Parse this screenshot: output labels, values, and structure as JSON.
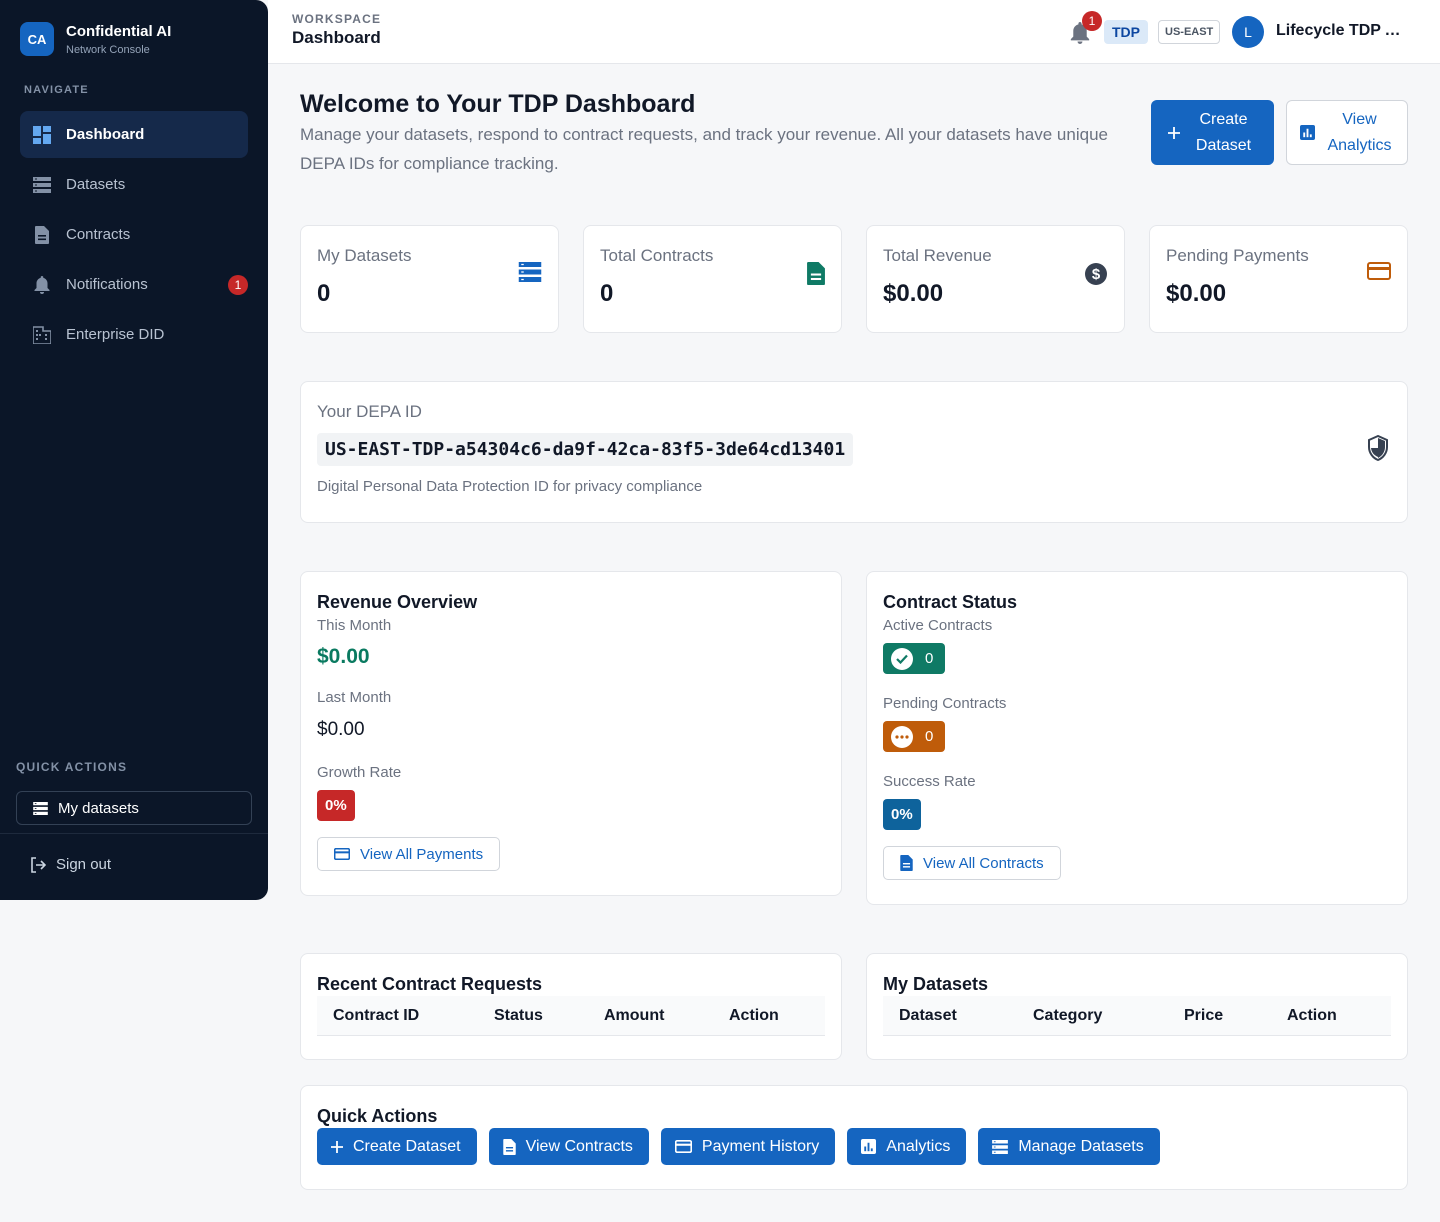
{
  "sidebar": {
    "brand_logo": "CA",
    "brand_title": "Confidential AI",
    "brand_subtitle": "Network Console",
    "nav_heading": "NAVIGATE",
    "items": [
      {
        "label": "Dashboard",
        "icon": "dashboard-icon",
        "active": true
      },
      {
        "label": "Datasets",
        "icon": "storage-icon"
      },
      {
        "label": "Contracts",
        "icon": "document-icon"
      },
      {
        "label": "Notifications",
        "icon": "bell-icon",
        "badge": "1"
      },
      {
        "label": "Enterprise DID",
        "icon": "building-icon"
      }
    ],
    "quick_actions_heading": "QUICK ACTIONS",
    "quick_action_button": "My datasets",
    "sign_out": "Sign out"
  },
  "header": {
    "workspace_label": "WORKSPACE",
    "title": "Dashboard",
    "notification_count": "1",
    "role_chip": "TDP",
    "region_chip": "US-EAST",
    "avatar_initial": "L",
    "user_name": "Lifecycle TDP Admin"
  },
  "welcome": {
    "title": "Welcome to Your TDP Dashboard",
    "subtitle": "Manage your datasets, respond to contract requests, and track your revenue. All your datasets have unique DEPA IDs for compliance tracking.",
    "create_button": "Create Dataset",
    "analytics_button": "View Analytics"
  },
  "stats": [
    {
      "label": "My Datasets",
      "value": "0",
      "icon": "storage-icon",
      "color": "#1565c0"
    },
    {
      "label": "Total Contracts",
      "value": "0",
      "icon": "document-icon",
      "color": "#0f7a65"
    },
    {
      "label": "Total Revenue",
      "value": "$0.00",
      "icon": "dollar-icon",
      "color": "#374151"
    },
    {
      "label": "Pending Payments",
      "value": "$0.00",
      "icon": "credit-card-icon",
      "color": "#bf5c0a"
    }
  ],
  "depa": {
    "label": "Your DEPA ID",
    "id": "US-EAST-TDP-a54304c6-da9f-42ca-83f5-3de64cd13401",
    "description": "Digital Personal Data Protection ID for privacy compliance"
  },
  "revenue": {
    "title": "Revenue Overview",
    "this_month_label": "This Month",
    "this_month_value": "$0.00",
    "last_month_label": "Last Month",
    "last_month_value": "$0.00",
    "growth_label": "Growth Rate",
    "growth_value": "0%",
    "view_button": "View All Payments"
  },
  "contract_status": {
    "title": "Contract Status",
    "active_label": "Active Contracts",
    "active_value": "0",
    "pending_label": "Pending Contracts",
    "pending_value": "0",
    "success_label": "Success Rate",
    "success_value": "0%",
    "view_button": "View All Contracts"
  },
  "recent_requests": {
    "title": "Recent Contract Requests",
    "columns": [
      "Contract ID",
      "Status",
      "Amount",
      "Action"
    ]
  },
  "my_datasets": {
    "title": "My Datasets",
    "columns": [
      "Dataset",
      "Category",
      "Price",
      "Action"
    ]
  },
  "quick_actions": {
    "title": "Quick Actions",
    "buttons": [
      "Create Dataset",
      "View Contracts",
      "Payment History",
      "Analytics",
      "Manage Datasets"
    ]
  },
  "colors": {
    "primary": "#1565c0",
    "sidebar_bg": "#0b1628",
    "danger": "#c62828",
    "success": "#0f7a65",
    "warning": "#bf5c0a",
    "info": "#0e639c"
  }
}
